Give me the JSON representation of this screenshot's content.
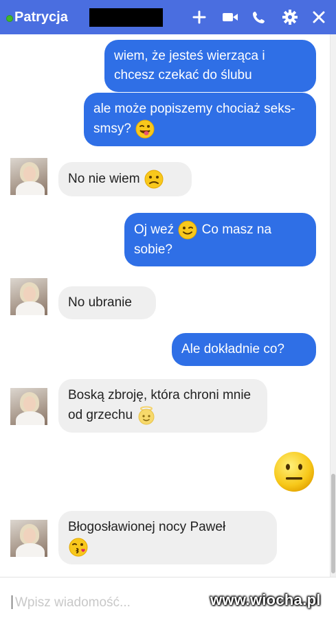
{
  "header": {
    "contact_name": "Patrycja",
    "status": "online",
    "icons": [
      "plus-icon",
      "video-icon",
      "phone-icon",
      "gear-icon",
      "close-icon"
    ],
    "colors": {
      "bar": "#4a6ee0",
      "status_dot": "#42b72a"
    }
  },
  "messages": [
    {
      "from": "me",
      "text": "wiem, że jesteś wierząca i chcesz czekać do ślubu"
    },
    {
      "from": "me",
      "text": "ale może popiszemy chociaż seks-smsy?",
      "emoji": "winking-tongue-emoji"
    },
    {
      "from": "her",
      "text": "No nie wiem",
      "emoji": "confused-emoji"
    },
    {
      "from": "me",
      "text_before": "Oj weź",
      "emoji": "wink-emoji",
      "text_after": "Co masz na sobie?"
    },
    {
      "from": "her",
      "text": "No ubranie"
    },
    {
      "from": "me",
      "text": "Ale dokładnie co?"
    },
    {
      "from": "her",
      "text": "Boską zbroję, która chroni mnie od grzechu",
      "emoji": "angel-emoji"
    },
    {
      "from": "me",
      "emoji": "neutral-face-emoji"
    },
    {
      "from": "her",
      "text": "Błogosławionej nocy Paweł",
      "emoji": "kiss-emoji"
    }
  ],
  "colors": {
    "outgoing_bubble": "#2f6fe6",
    "incoming_bubble": "#efefef"
  },
  "composer": {
    "placeholder": "Wpisz wiadomość..."
  },
  "watermark": "www.wiocha.pl"
}
